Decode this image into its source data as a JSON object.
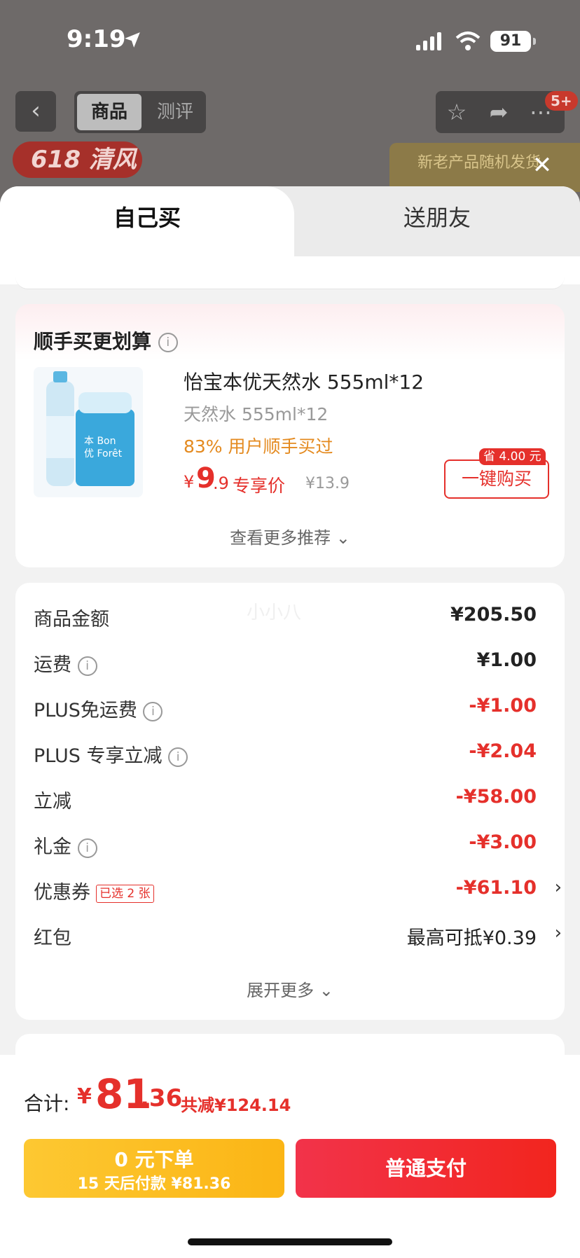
{
  "status_bar": {
    "time": "9:19",
    "battery": "91"
  },
  "nav": {
    "back_icon": "chevron-left-icon",
    "tabs": [
      {
        "label": "商品"
      },
      {
        "label": "测评"
      }
    ],
    "badge": "5+",
    "promo_left": "618 清风",
    "promo_right": "新老产品随机发货"
  },
  "sheet": {
    "tabs": [
      {
        "label": "自己买"
      },
      {
        "label": "送朋友"
      }
    ],
    "recommend": {
      "title": "顺手买更划算",
      "product": {
        "name": "怡宝本优天然水 555ml*12",
        "spec": "天然水 555ml*12",
        "share": "83% 用户顺手买过",
        "price_symbol": "¥",
        "price_int": "9",
        "price_dec": ".9",
        "price_tag": "专享价",
        "original_price": "¥13.9",
        "save_badge": "省 4.00 元",
        "buy_label": "一键购买"
      },
      "more": "查看更多推荐"
    },
    "watermark": "小小八",
    "costs": [
      {
        "label": "商品金额",
        "value": "¥205.50",
        "red": false
      },
      {
        "label": "运费",
        "value": "¥1.00",
        "red": false,
        "info": true
      },
      {
        "label": "PLUS免运费",
        "value": "-¥1.00",
        "red": true,
        "info": true
      },
      {
        "label": "PLUS 专享立减",
        "value": "-¥2.04",
        "red": true,
        "info": true
      },
      {
        "label": "立减",
        "value": "-¥58.00",
        "red": true
      },
      {
        "label": "礼金",
        "value": "-¥3.00",
        "red": true,
        "info": true
      },
      {
        "label": "优惠券",
        "value": "-¥61.10",
        "red": true,
        "tag": "已选 2 张",
        "chevron": true
      },
      {
        "label": "红包",
        "value": "最高可抵¥0.39",
        "red": false,
        "chevron": true
      }
    ],
    "expand_more": "展开更多"
  },
  "footer": {
    "total_label": "合计:",
    "total_symbol": "¥",
    "total_int": "81",
    "total_dec": ".36",
    "total_save": "共减¥124.14",
    "zero_btn_line1": "0 元下单",
    "zero_btn_line2": "15 天后付款 ¥81.36",
    "pay_btn": "普通支付"
  },
  "colors": {
    "accent_red": "#e5302b",
    "orange": "#e48a1f",
    "yellow": "#fdc832"
  }
}
